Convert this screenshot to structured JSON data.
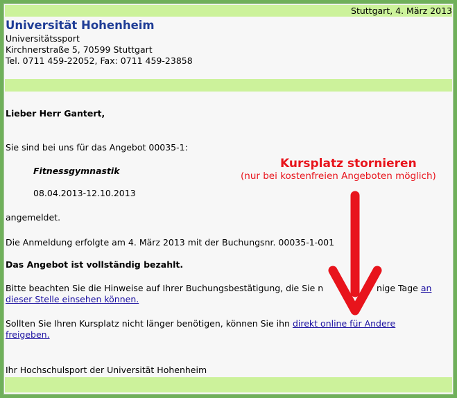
{
  "header": {
    "date": "Stuttgart, 4. März 2013",
    "university": "Universität Hohenheim",
    "department": "Universitätssport",
    "address": "Kirchnerstraße 5, 70599 Stuttgart",
    "phone_fax": "Tel. 0711 459-22052, Fax: 0711 459-23858"
  },
  "letter": {
    "salutation": "Lieber Herr Gantert,",
    "intro": "Sie sind bei uns für das Angebot 00035-1:",
    "course_name": "Fitnessgymnastik",
    "course_dates": "08.04.2013-12.10.2013",
    "registered": "angemeldet.",
    "booking_line": "Die Anmeldung erfolgte am 4. März 2013 mit der Buchungsnr. 00035-1-001",
    "paid": "Das Angebot ist vollständig bezahlt.",
    "notes_text": "Bitte beachten Sie die Hinweise auf Ihrer Buchungsbestätigung, die Sie n",
    "notes_text_cont": "nige Tage",
    "notes_link_1": "an",
    "notes_link_2": "dieser Stelle einsehen können.",
    "cancel_text": "Sollten Sie Ihren Kursplatz nicht länger benötigen, können Sie ihn",
    "cancel_link_1": "direkt online für Andere",
    "cancel_link_2": "freigeben.",
    "closing": "Ihr Hochschulsport der Universität Hohenheim"
  },
  "annotation": {
    "title": "Kursplatz stornieren",
    "subtitle": "(nur bei kostenfreien Angeboten möglich)",
    "color": "#e8141c"
  },
  "colors": {
    "frame": "#6fb05a",
    "bar": "#ccf29b",
    "title": "#1f3d96",
    "link": "#1a0fa0"
  }
}
